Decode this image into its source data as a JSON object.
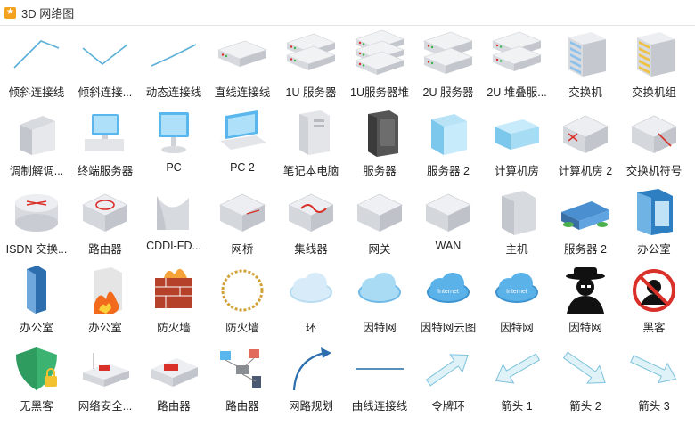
{
  "header": {
    "icon": "library-icon",
    "title": "3D 网络图"
  },
  "items": [
    {
      "label": "倾斜连接线",
      "icon": "slanted-connector-icon"
    },
    {
      "label": "倾斜连接...",
      "icon": "slanted-connector-2-icon"
    },
    {
      "label": "动态连接线",
      "icon": "dynamic-connector-icon"
    },
    {
      "label": "直线连接线",
      "icon": "straight-connector-server-icon"
    },
    {
      "label": "1U 服务器",
      "icon": "1u-server-icon"
    },
    {
      "label": "1U服务器堆",
      "icon": "1u-server-stack-icon"
    },
    {
      "label": "2U 服务器",
      "icon": "2u-server-icon"
    },
    {
      "label": "2U 堆叠服...",
      "icon": "2u-server-stack-icon"
    },
    {
      "label": "交换机",
      "icon": "switch-icon"
    },
    {
      "label": "交换机组",
      "icon": "switch-group-icon"
    },
    {
      "label": "调制解调...",
      "icon": "modem-icon"
    },
    {
      "label": "终端服务器",
      "icon": "terminal-server-icon"
    },
    {
      "label": "PC",
      "icon": "pc-icon"
    },
    {
      "label": "PC 2",
      "icon": "pc-2-icon"
    },
    {
      "label": "笔记本电脑",
      "icon": "laptop-icon"
    },
    {
      "label": "服务器",
      "icon": "server-tower-icon"
    },
    {
      "label": "服务器 2",
      "icon": "server-2-glass-icon"
    },
    {
      "label": "计算机房",
      "icon": "computer-room-icon"
    },
    {
      "label": "计算机房 2",
      "icon": "computer-room-2-icon"
    },
    {
      "label": "交换机符号",
      "icon": "switch-symbol-icon"
    },
    {
      "label": "ISDN 交换...",
      "icon": "isdn-switch-icon"
    },
    {
      "label": "路由器",
      "icon": "router-cylinder-icon"
    },
    {
      "label": "CDDI-FD...",
      "icon": "cddi-fddi-icon"
    },
    {
      "label": "网桥",
      "icon": "bridge-icon"
    },
    {
      "label": "集线器",
      "icon": "hub-icon"
    },
    {
      "label": "网关",
      "icon": "gateway-icon"
    },
    {
      "label": "WAN",
      "icon": "wan-icon"
    },
    {
      "label": "主机",
      "icon": "mainframe-icon"
    },
    {
      "label": "服务器 2",
      "icon": "server-building-icon"
    },
    {
      "label": "办公室",
      "icon": "office-building-icon"
    },
    {
      "label": "办公室",
      "icon": "office-tower-icon"
    },
    {
      "label": "办公室",
      "icon": "office-burning-icon"
    },
    {
      "label": "防火墙",
      "icon": "firewall-icon"
    },
    {
      "label": "防火墙",
      "icon": "firewall-ring-icon"
    },
    {
      "label": "环",
      "icon": "ring-cloud-icon"
    },
    {
      "label": "因特网",
      "icon": "internet-cloud-icon"
    },
    {
      "label": "因特网云图",
      "icon": "internet-cloud-label-icon"
    },
    {
      "label": "因特网",
      "icon": "internet-cloud-2-icon"
    },
    {
      "label": "因特网",
      "icon": "hacker-icon"
    },
    {
      "label": "黑客",
      "icon": "no-hacker-icon"
    },
    {
      "label": "无黑客",
      "icon": "shield-lock-icon"
    },
    {
      "label": "网络安全...",
      "icon": "network-security-icon"
    },
    {
      "label": "路由器",
      "icon": "router-box-icon"
    },
    {
      "label": "路由器",
      "icon": "router-diagram-icon"
    },
    {
      "label": "网路规划",
      "icon": "curved-arrow-icon"
    },
    {
      "label": "曲线连接线",
      "icon": "curve-connector-icon"
    },
    {
      "label": "令牌环",
      "icon": "token-ring-arrow-icon"
    },
    {
      "label": "箭头 1",
      "icon": "arrow-1-icon"
    },
    {
      "label": "箭头 2",
      "icon": "arrow-2-icon"
    },
    {
      "label": "箭头 3",
      "icon": "arrow-3-icon"
    }
  ],
  "colors": {
    "accent": "#4aa3d8",
    "boxTop": "#eceef1",
    "boxSide": "#c9ccd2",
    "red": "#d9302a"
  }
}
